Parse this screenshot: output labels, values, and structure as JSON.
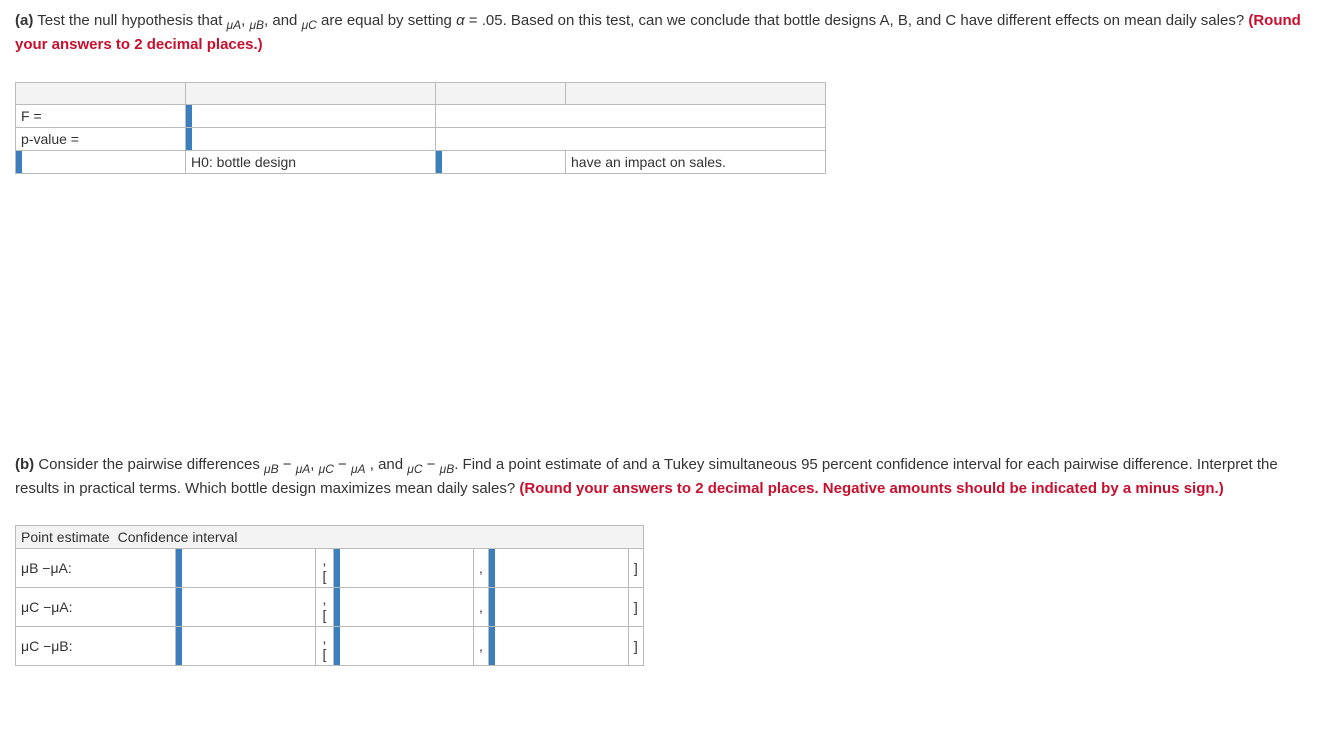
{
  "partA": {
    "label": "(a)",
    "text1": "Test the null hypothesis that ",
    "mu_a": "μA",
    "sep1": ", ",
    "mu_b": "μB",
    "sep2": ", and ",
    "mu_c": "μC",
    "text2": " are equal by setting ",
    "alpha": "α",
    "text3": " = .05. Based on this test, can we conclude that bottle designs A, B, and C have different effects on mean daily sales? ",
    "round": "(Round your answers to 2 decimal places.)"
  },
  "tableA": {
    "r1c1": "F =",
    "r2c1": "p-value =",
    "r3c2": "H0: bottle design",
    "r3c4": "have an impact on sales."
  },
  "partB": {
    "label": "(b)",
    "text1": "Consider the pairwise differences ",
    "d1a": "μB",
    "d1m": " − ",
    "d1b": "μA",
    "sep1": ", ",
    "d2a": "μC",
    "d2m": " − ",
    "d2b": "μA",
    "sep2": " , and ",
    "d3a": "μC",
    "d3m": " − ",
    "d3b": "μB",
    "text2": ". Find a point estimate of and a Tukey simultaneous 95 percent confidence interval for each pairwise difference. Interpret the results in practical terms. Which bottle design maximizes mean daily sales? ",
    "round": "(Round your answers to 2 decimal places. Negative amounts should be indicated by a minus sign.)"
  },
  "tableB": {
    "hdr1": "Point estimate",
    "hdr2": "Confidence interval",
    "row1": "μB −μA:",
    "row2": "μC −μA:",
    "row3": "μC −μB:",
    "openBracket": ", [",
    "comma": ",",
    "closeBracket": "]"
  }
}
